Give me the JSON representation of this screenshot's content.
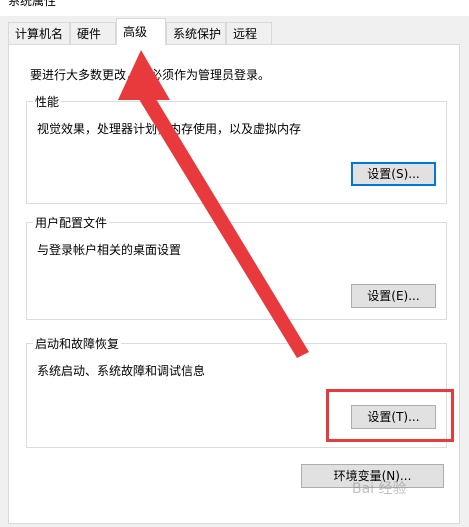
{
  "tabs": [
    {
      "label": "计算机名"
    },
    {
      "label": "硬件"
    },
    {
      "label": "高级"
    },
    {
      "label": "系统保护"
    },
    {
      "label": "远程"
    }
  ],
  "intro": "要进行大多数更改，你必须作为管理员登录。",
  "groups": [
    {
      "title": "性能",
      "description": "视觉效果，处理器计划，内存使用，以及虚拟内存",
      "button_label": "设置(S)..."
    },
    {
      "title": "用户配置文件",
      "description": "与登录帐户相关的桌面设置",
      "button_label": "设置(E)..."
    },
    {
      "title": "启动和故障恢复",
      "description": "系统启动、系统故障和调试信息",
      "button_label": "设置(T)..."
    }
  ],
  "env_button_label": "环境变量(N)...",
  "watermark": "Bai 经验",
  "colors": {
    "panel": "#ffffff",
    "background": "#f0f0f0",
    "annotation": "#e8393c",
    "focus": "#0078d7"
  }
}
